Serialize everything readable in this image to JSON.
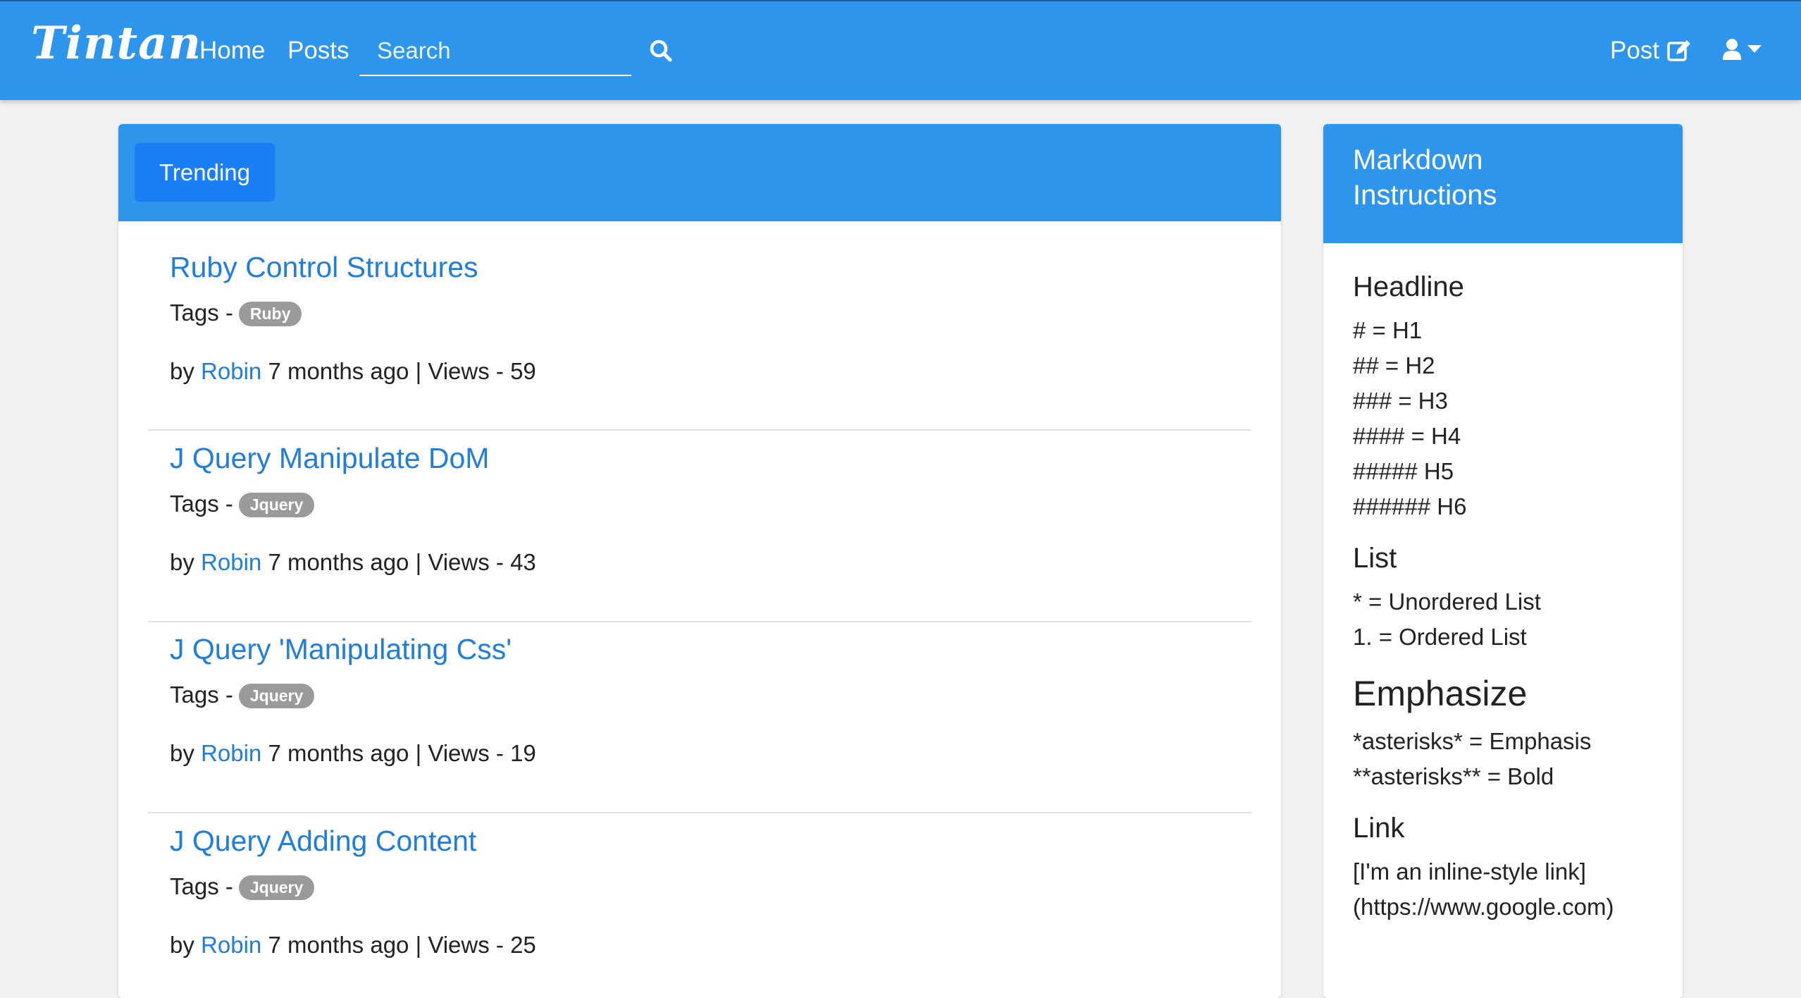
{
  "navbar": {
    "brand": "Tintan",
    "links": [
      "Home",
      "Posts"
    ],
    "search_placeholder": "Search",
    "post_label": "Post"
  },
  "main": {
    "tab": "Trending",
    "posts": [
      {
        "title": "Ruby Control Structures",
        "tags_label": "Tags -",
        "tag": "Ruby",
        "by": "by",
        "author": "Robin",
        "meta": "7 months ago | Views - 59"
      },
      {
        "title": "J Query Manipulate DoM",
        "tags_label": "Tags -",
        "tag": "Jquery",
        "by": "by",
        "author": "Robin",
        "meta": "7 months ago | Views - 43"
      },
      {
        "title": "J Query 'Manipulating Css'",
        "tags_label": "Tags -",
        "tag": "Jquery",
        "by": "by",
        "author": "Robin",
        "meta": "7 months ago | Views - 19"
      },
      {
        "title": "J Query Adding Content",
        "tags_label": "Tags -",
        "tag": "Jquery",
        "by": "by",
        "author": "Robin",
        "meta": "7 months ago | Views - 25"
      }
    ]
  },
  "sidebar": {
    "title_line1": "Markdown",
    "title_line2": "Instructions",
    "sections": [
      {
        "heading": "Headline",
        "lines": [
          "# = H1",
          "## = H2",
          "### = H3",
          "#### = H4",
          "##### H5",
          "###### H6"
        ]
      },
      {
        "heading": "List",
        "lines": [
          "* = Unordered List",
          "1. = Ordered List"
        ]
      },
      {
        "heading": "Emphasize",
        "lines": [
          "*asterisks* = Emphasis",
          "**asterisks** = Bold"
        ]
      },
      {
        "heading": "Link",
        "lines": [
          "[I'm an inline-style link]",
          "(https://www.google.com)"
        ]
      }
    ]
  }
}
